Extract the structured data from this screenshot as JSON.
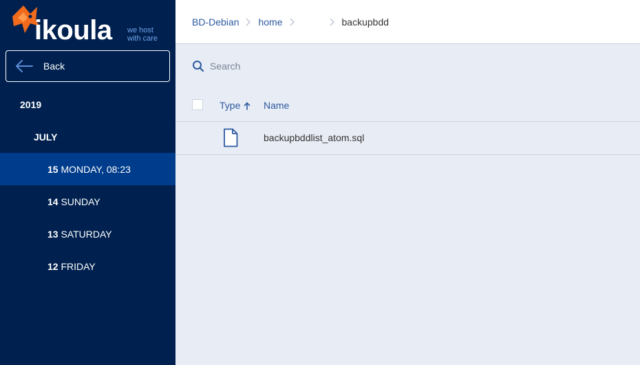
{
  "brand": {
    "logo_text": "ikoula",
    "tagline_line1": "we host",
    "tagline_line2": "with care",
    "accent_color": "#f26b1d"
  },
  "sidebar": {
    "back_label": "Back",
    "tree": [
      {
        "bold": "2019",
        "rest": "",
        "level": 0,
        "active": false
      },
      {
        "bold": "JULY",
        "rest": "",
        "level": 1,
        "active": false
      },
      {
        "bold": "15",
        "rest": " MONDAY, 08:23",
        "level": 2,
        "active": true
      },
      {
        "bold": "14",
        "rest": " SUNDAY",
        "level": 2,
        "active": false
      },
      {
        "bold": "13",
        "rest": " SATURDAY",
        "level": 2,
        "active": false
      },
      {
        "bold": "12",
        "rest": " FRIDAY",
        "level": 2,
        "active": false
      }
    ]
  },
  "breadcrumb": {
    "items": [
      "BD-Debian",
      "home",
      "backupbdd"
    ]
  },
  "search": {
    "placeholder": "Search"
  },
  "table": {
    "columns": {
      "type": "Type",
      "name": "Name"
    },
    "sort": "ascending",
    "rows": [
      {
        "type_icon": "file-icon",
        "name": "backupbddlist_atom.sql"
      }
    ]
  }
}
